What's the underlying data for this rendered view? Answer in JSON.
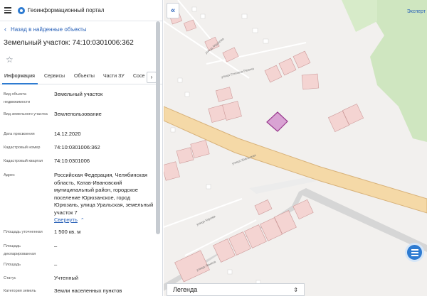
{
  "header": {
    "portal_title": "Геоинформационный портал"
  },
  "back_link": "Назад в найденные объекты",
  "page_title": "Земельный участок: 74:10:0301006:362",
  "tabs": [
    {
      "label": "Информация"
    },
    {
      "label": "Сервисы"
    },
    {
      "label": "Объекты"
    },
    {
      "label": "Части ЗУ"
    },
    {
      "label": "Сосе"
    }
  ],
  "fields": [
    {
      "label": "Вид объекта недвижимости",
      "value": "Земельный участок"
    },
    {
      "label": "Вид земельного участка",
      "value": "Землепользование"
    },
    {
      "label": "Дата присвоения",
      "value": "14.12.2020"
    },
    {
      "label": "Кадастровый номер",
      "value": "74:10:0301006:362"
    },
    {
      "label": "Кадастровый квартал",
      "value": "74:10:0301006"
    },
    {
      "label": "Адрес",
      "value": "Российская Федерация, Челябинская область, Катав-Ивановский муниципальный район, городское поселение Юрюзанское, город Юрюзань, улица Уральская, земельный участок 7"
    },
    {
      "label": "Площадь уточненная",
      "value": "1 500 кв. м"
    },
    {
      "label": "Площадь декларированная",
      "value": "–"
    },
    {
      "label": "Площадь",
      "value": "–"
    },
    {
      "label": "Статус",
      "value": "Учтенный"
    },
    {
      "label": "Категория земель",
      "value": "Земли населенных пунктов"
    }
  ],
  "collapse_link": "Свернуть",
  "map": {
    "mode_label": "Эксперт",
    "legend_label": "Легенда",
    "street_labels": [
      "улица Уральская",
      "улица Кирова",
      "улица Ленина",
      "улица Степана Разина",
      "улица Жданова"
    ]
  }
}
